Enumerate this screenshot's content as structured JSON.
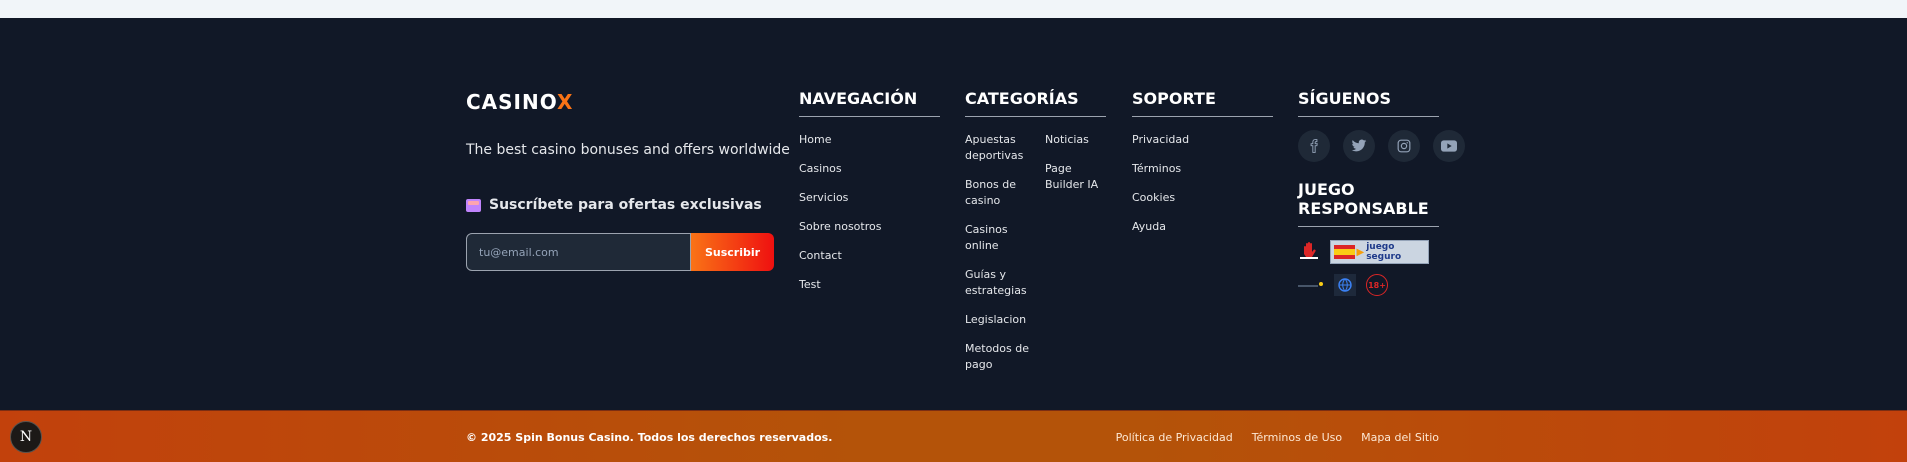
{
  "brand": {
    "name": "CASINO",
    "accent": "X",
    "tagline": "The best casino bonuses and offers worldwide"
  },
  "subscribe": {
    "title": "Suscríbete para ofertas exclusivas",
    "placeholder": "tu@email.com",
    "button": "Suscribir"
  },
  "nav": {
    "title": "NAVEGACIÓN",
    "items": [
      "Home",
      "Casinos",
      "Servicios",
      "Sobre nosotros",
      "Contact",
      "Test"
    ]
  },
  "categories": {
    "title": "CATEGORÍAS",
    "col1": [
      "Apuestas deportivas",
      "Bonos de casino",
      "Casinos online",
      "Guías y estrategias",
      "Legislacion",
      "Metodos de pago"
    ],
    "col2": [
      "Noticias",
      "Page Builder IA"
    ]
  },
  "support": {
    "title": "SOPORTE",
    "items": [
      "Privacidad",
      "Términos",
      "Cookies",
      "Ayuda"
    ]
  },
  "social": {
    "title": "SÍGUENOS",
    "icons": [
      "facebook-icon",
      "twitter-icon",
      "instagram-icon",
      "youtube-icon"
    ]
  },
  "responsible": {
    "title": "JUEGO RESPONSABLE",
    "badge_text": "juego seguro",
    "age_badge": "18+"
  },
  "bottom": {
    "copyright": "© 2025 Spin Bonus Casino. Todos los derechos reservados.",
    "links": [
      "Política de Privacidad",
      "Términos de Uso",
      "Mapa del Sitio"
    ]
  },
  "dev_badge": "N",
  "colors": {
    "bg": "#111827",
    "accent": "#f97316",
    "bar_start": "#c2410c",
    "bar_mid": "#b45309"
  }
}
